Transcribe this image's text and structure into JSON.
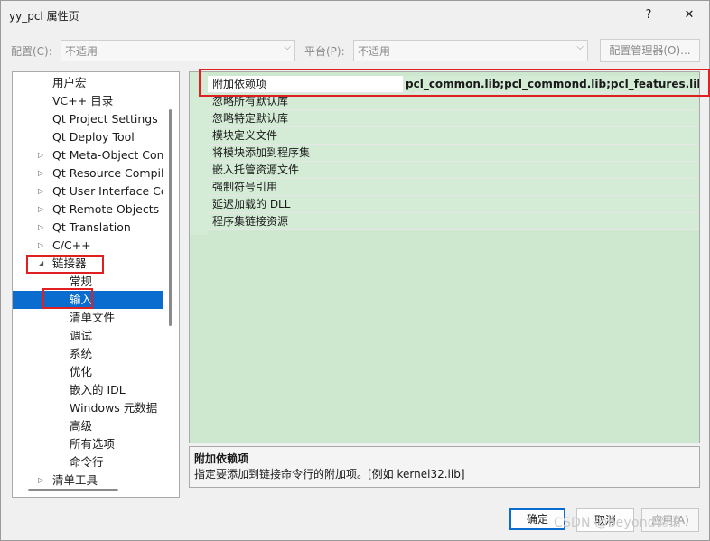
{
  "window": {
    "title": "yy_pcl 属性页",
    "help": "?",
    "close": "✕"
  },
  "config": {
    "label": "配置(C):",
    "value": "不适用"
  },
  "platform": {
    "label": "平台(P):",
    "value": "不适用"
  },
  "config_manager_button": "配置管理器(O)...",
  "tree": {
    "items": [
      {
        "label": "用户宏",
        "arrow": ""
      },
      {
        "label": "VC++ 目录",
        "arrow": ""
      },
      {
        "label": "Qt Project Settings",
        "arrow": ""
      },
      {
        "label": "Qt Deploy Tool",
        "arrow": ""
      },
      {
        "label": "Qt Meta-Object Com",
        "arrow": "▷"
      },
      {
        "label": "Qt Resource Compile",
        "arrow": "▷"
      },
      {
        "label": "Qt User Interface Co",
        "arrow": "▷"
      },
      {
        "label": "Qt Remote Objects C",
        "arrow": "▷"
      },
      {
        "label": "Qt Translation",
        "arrow": "▷"
      },
      {
        "label": "C/C++",
        "arrow": "▷"
      },
      {
        "label": "链接器",
        "arrow": "◢"
      },
      {
        "label": "常规",
        "arrow": ""
      },
      {
        "label": "输入",
        "arrow": ""
      },
      {
        "label": "清单文件",
        "arrow": ""
      },
      {
        "label": "调试",
        "arrow": ""
      },
      {
        "label": "系统",
        "arrow": ""
      },
      {
        "label": "优化",
        "arrow": ""
      },
      {
        "label": "嵌入的 IDL",
        "arrow": ""
      },
      {
        "label": "Windows 元数据",
        "arrow": ""
      },
      {
        "label": "高级",
        "arrow": ""
      },
      {
        "label": "所有选项",
        "arrow": ""
      },
      {
        "label": "命令行",
        "arrow": ""
      },
      {
        "label": "清单工具",
        "arrow": "▷"
      }
    ],
    "selected": "输入"
  },
  "grid": {
    "rows": [
      {
        "name": "附加依赖项",
        "value": "pcl_common.lib;pcl_commond.lib;pcl_features.lib;pcl_"
      },
      {
        "name": "忽略所有默认库",
        "value": ""
      },
      {
        "name": "忽略特定默认库",
        "value": ""
      },
      {
        "name": "模块定义文件",
        "value": ""
      },
      {
        "name": "将模块添加到程序集",
        "value": ""
      },
      {
        "name": "嵌入托管资源文件",
        "value": ""
      },
      {
        "name": "强制符号引用",
        "value": ""
      },
      {
        "name": "延迟加载的 DLL",
        "value": ""
      },
      {
        "name": "程序集链接资源",
        "value": ""
      }
    ]
  },
  "description": {
    "title": "附加依赖项",
    "text": "指定要添加到链接命令行的附加项。[例如 kernel32.lib]"
  },
  "buttons": {
    "ok": "确定",
    "cancel": "取消",
    "apply": "应用(A)"
  },
  "watermark": "CSDN @beyond谚语",
  "colors": {
    "grid_bg": "#cde8cf",
    "selection": "#0a6ccf",
    "highlight_box": "#e02020"
  }
}
